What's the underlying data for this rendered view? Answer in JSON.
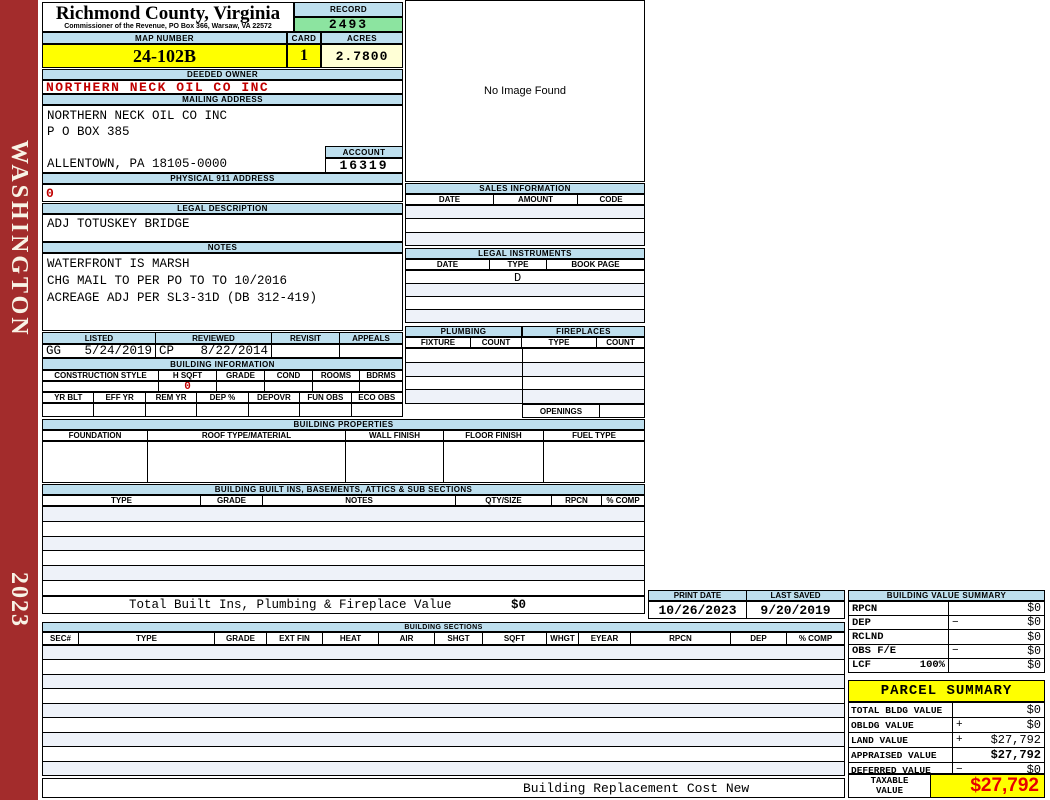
{
  "colors": {
    "header_blue": "#BEDFEE",
    "record_green": "#8CE4A0",
    "highlight_yellow": "#FFFF00",
    "acres_cream": "#FFFFD6",
    "sidebar_red": "#A32C2C",
    "alert_red": "#C00000",
    "taxable_red": "#E60000",
    "row_tint": "#EEF2F9"
  },
  "sidebar": {
    "district": "WASHINGTON",
    "year": "2023"
  },
  "header": {
    "county": "Richmond County, Virginia",
    "commissioner_line": "Commissioner of the Revenue, PO Box 366, Warsaw, VA 22572",
    "record_label": "RECORD",
    "record_value": "2493",
    "map_number_label": "MAP NUMBER",
    "map_number": "24-102B",
    "card_label": "CARD",
    "card": "1",
    "acres_label": "ACRES",
    "acres": "2.7800"
  },
  "owner": {
    "deeded_owner_label": "DEEDED OWNER",
    "deeded_owner": "NORTHERN NECK OIL CO INC",
    "mailing_label": "MAILING ADDRESS",
    "mailing_lines": [
      "NORTHERN NECK OIL CO INC",
      "P O BOX 385",
      "",
      "ALLENTOWN, PA 18105-0000"
    ],
    "account_label": "ACCOUNT",
    "account": "16319",
    "physical_label": "PHYSICAL 911 ADDRESS",
    "physical_address": "0"
  },
  "legal": {
    "label": "LEGAL DESCRIPTION",
    "description": "ADJ TOTUSKEY BRIDGE"
  },
  "notes": {
    "label": "NOTES",
    "lines": [
      "WATERFRONT IS MARSH",
      "CHG MAIL TO PER PO TO TO 10/2016",
      "ACREAGE ADJ PER SL3-31D (DB 312-419)"
    ]
  },
  "review": {
    "columns": [
      "LISTED",
      "REVIEWED",
      "REVISIT",
      "APPEALS"
    ],
    "listed_by": "GG",
    "listed_date": "5/24/2019",
    "reviewed_by": "CP",
    "reviewed_date": "8/22/2014",
    "revisit": "",
    "appeals": ""
  },
  "building_info": {
    "label": "BUILDING INFORMATION",
    "columns_row1": [
      "CONSTRUCTION STYLE",
      "H SQFT",
      "GRADE",
      "COND",
      "ROOMS",
      "BDRMS"
    ],
    "h_sqft": "0",
    "columns_row2": [
      "YR BLT",
      "EFF YR",
      "REM YR",
      "DEP %",
      "DEPOVR",
      "FUN OBS",
      "ECO OBS"
    ]
  },
  "image_panel": {
    "message": "No Image Found"
  },
  "sales": {
    "label": "SALES INFORMATION",
    "columns": [
      "DATE",
      "AMOUNT",
      "CODE"
    ]
  },
  "legal_instruments": {
    "label": "LEGAL INSTRUMENTS",
    "columns": [
      "DATE",
      "TYPE",
      "BOOK PAGE"
    ],
    "row1_type": "D"
  },
  "plumbing": {
    "label": "PLUMBING",
    "columns": [
      "FIXTURE",
      "COUNT"
    ]
  },
  "fireplaces": {
    "label": "FIREPLACES",
    "columns": [
      "TYPE",
      "COUNT"
    ],
    "openings_label": "OPENINGS"
  },
  "building_properties": {
    "label": "BUILDING PROPERTIES",
    "columns": [
      "FOUNDATION",
      "ROOF TYPE/MATERIAL",
      "WALL FINISH",
      "FLOOR FINISH",
      "FUEL TYPE"
    ]
  },
  "built_ins": {
    "label": "BUILDING BUILT INS, BASEMENTS, ATTICS & SUB SECTIONS",
    "columns": [
      "TYPE",
      "GRADE",
      "NOTES",
      "QTY/SIZE",
      "RPCN",
      "% COMP"
    ],
    "total_label": "Total Built Ins, Plumbing & Fireplace Value",
    "total_value": "$0"
  },
  "print_info": {
    "print_date_label": "PRINT DATE",
    "print_date": "10/26/2023",
    "last_saved_label": "LAST SAVED",
    "last_saved": "9/20/2019"
  },
  "building_value_summary": {
    "label": "BUILDING VALUE SUMMARY",
    "rows": [
      {
        "label": "RPCN",
        "pct": "",
        "op": "",
        "value": "$0"
      },
      {
        "label": "DEP",
        "pct": "",
        "op": "−",
        "value": "$0"
      },
      {
        "label": "RCLND",
        "pct": "",
        "op": "",
        "value": "$0"
      },
      {
        "label": "OBS F/E",
        "pct": "",
        "op": "−",
        "value": "$0"
      },
      {
        "label": "LCF",
        "pct": "100%",
        "op": "",
        "value": "$0"
      }
    ]
  },
  "building_sections": {
    "label": "BUILDING SECTIONS",
    "columns": [
      "SEC#",
      "TYPE",
      "GRADE",
      "EXT FIN",
      "HEAT",
      "AIR",
      "SHGT",
      "SQFT",
      "WHGT",
      "EYEAR",
      "RPCN",
      "DEP",
      "% COMP"
    ]
  },
  "parcel_summary": {
    "label": "PARCEL SUMMARY",
    "rows": [
      {
        "label": "TOTAL BLDG VALUE",
        "op": "",
        "value": "$0"
      },
      {
        "label": "OBLDG VALUE",
        "op": "+",
        "value": "$0"
      },
      {
        "label": "LAND VALUE",
        "op": "+",
        "value": "$27,792"
      },
      {
        "label": "APPRAISED VALUE",
        "op": "",
        "value": "$27,792"
      },
      {
        "label": "DEFERRED VALUE",
        "op": "−",
        "value": "$0"
      }
    ],
    "taxable_label": "TAXABLE VALUE",
    "taxable_value": "$27,792"
  },
  "footer": {
    "replacement_cost_label": "Building Replacement Cost New"
  }
}
